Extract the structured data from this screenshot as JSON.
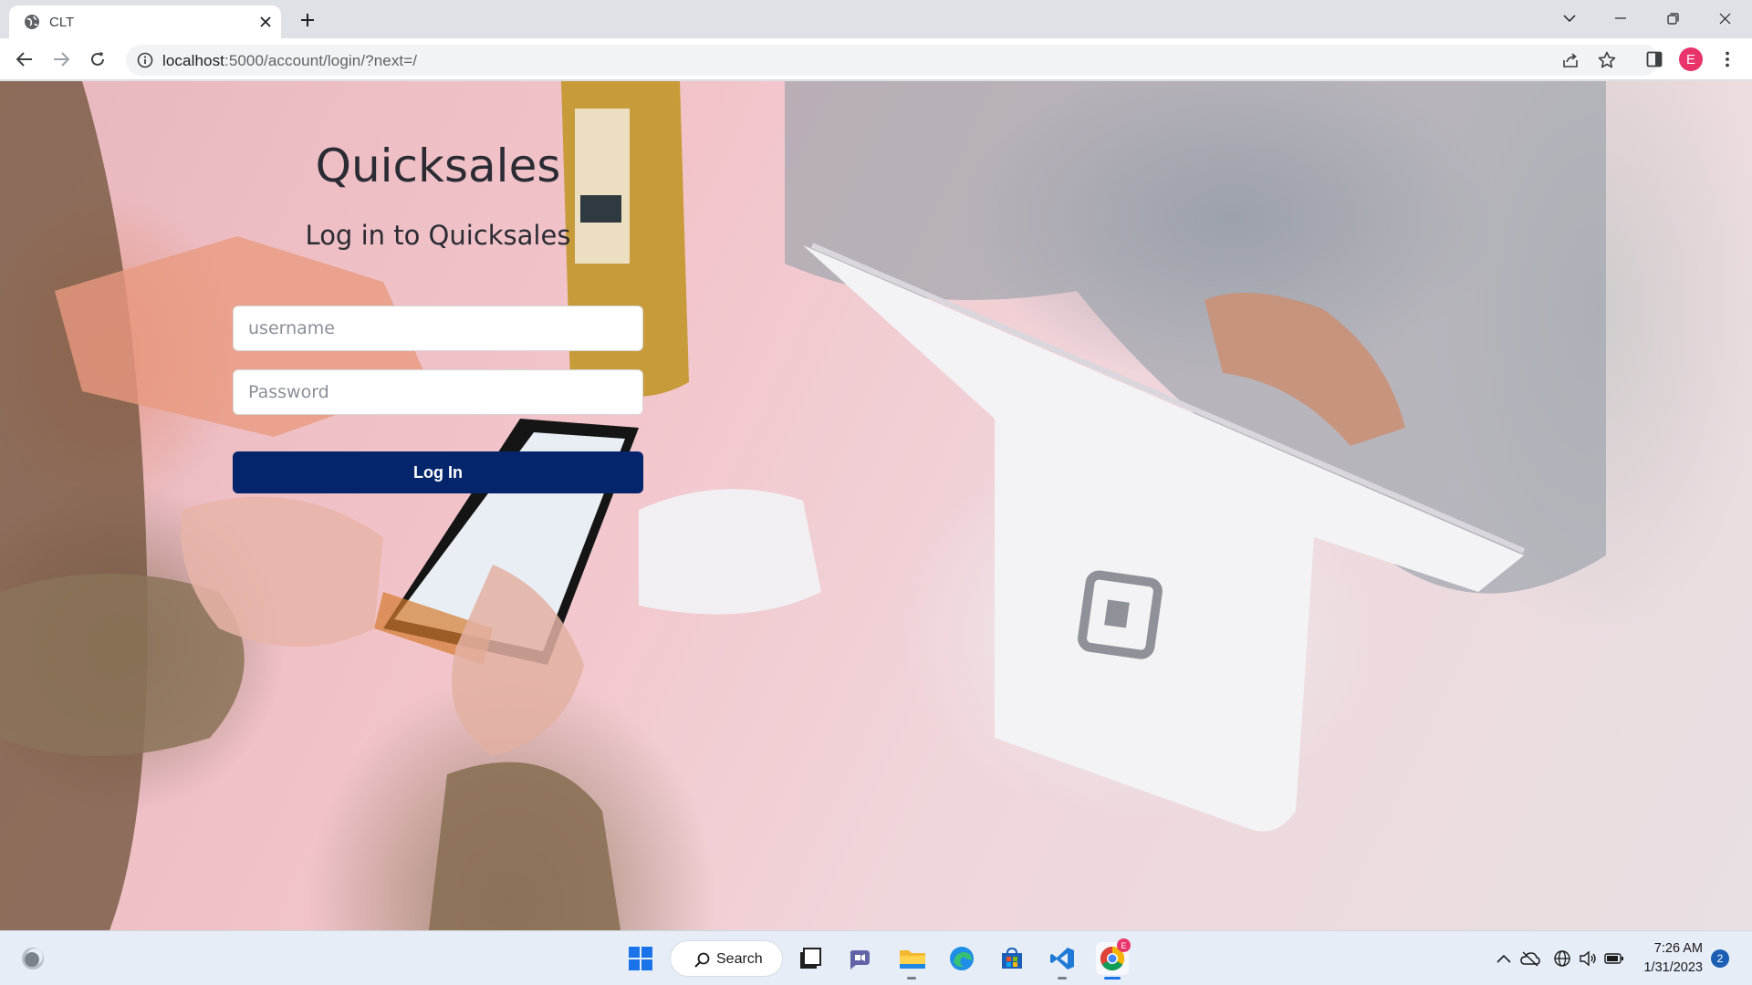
{
  "browser": {
    "tab_title": "CLT",
    "url_host": "localhost",
    "url_rest": ":5000/account/login/?next=/",
    "profile_initial": "E"
  },
  "page": {
    "app_title": "Quicksales",
    "subtitle": "Log in to Quicksales",
    "username_placeholder": "username",
    "password_placeholder": "Password",
    "login_button": "Log In"
  },
  "taskbar": {
    "search_label": "Search",
    "time": "7:26 AM",
    "date": "1/31/2023",
    "notification_count": "2",
    "chrome_badge": "E"
  },
  "colors": {
    "login_button": "#04256b",
    "profile": "#e8336b",
    "notification": "#1a5fb4"
  }
}
